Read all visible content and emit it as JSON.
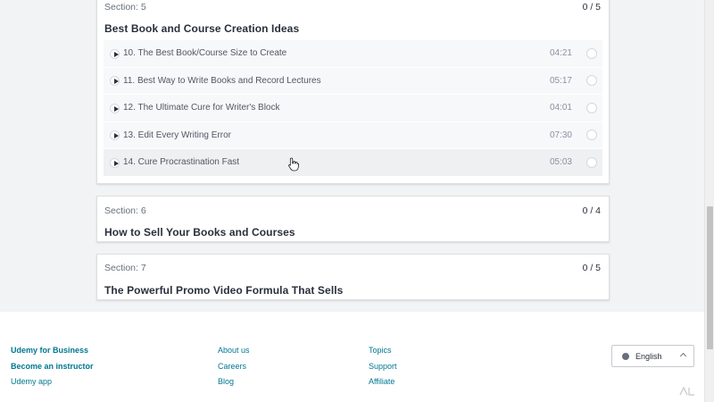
{
  "sections": [
    {
      "label": "Section: 5",
      "count": "0 / 5",
      "title": "Best Book and Course Creation Ideas",
      "lectures": [
        {
          "title": "10. The Best Book/Course Size to Create",
          "duration": "04:21"
        },
        {
          "title": "11. Best Way to Write Books and Record Lectures",
          "duration": "05:17"
        },
        {
          "title": "12. The Ultimate Cure for Writer's Block",
          "duration": "04:01"
        },
        {
          "title": "13. Edit Every Writing Error",
          "duration": "07:30"
        },
        {
          "title": "14. Cure Procrastination Fast",
          "duration": "05:03"
        }
      ]
    },
    {
      "label": "Section: 6",
      "count": "0 / 4",
      "title": "How to Sell Your Books and Courses"
    },
    {
      "label": "Section: 7",
      "count": "0 / 5",
      "title": "The Powerful Promo Video Formula That Sells"
    }
  ],
  "footer": {
    "col1": [
      "Udemy for Business",
      "Become an instructor",
      "Udemy app"
    ],
    "col2": [
      "About us",
      "Careers",
      "Blog"
    ],
    "col3": [
      "Topics",
      "Support",
      "Affiliate"
    ],
    "language": "English"
  },
  "colors": {
    "accent": "#007791",
    "text": "#29303b",
    "muted": "#686f7a"
  },
  "icons": {
    "play": "play-icon",
    "check": "circle-check-icon",
    "globe": "globe-icon",
    "chevron": "chevron-up-icon"
  }
}
